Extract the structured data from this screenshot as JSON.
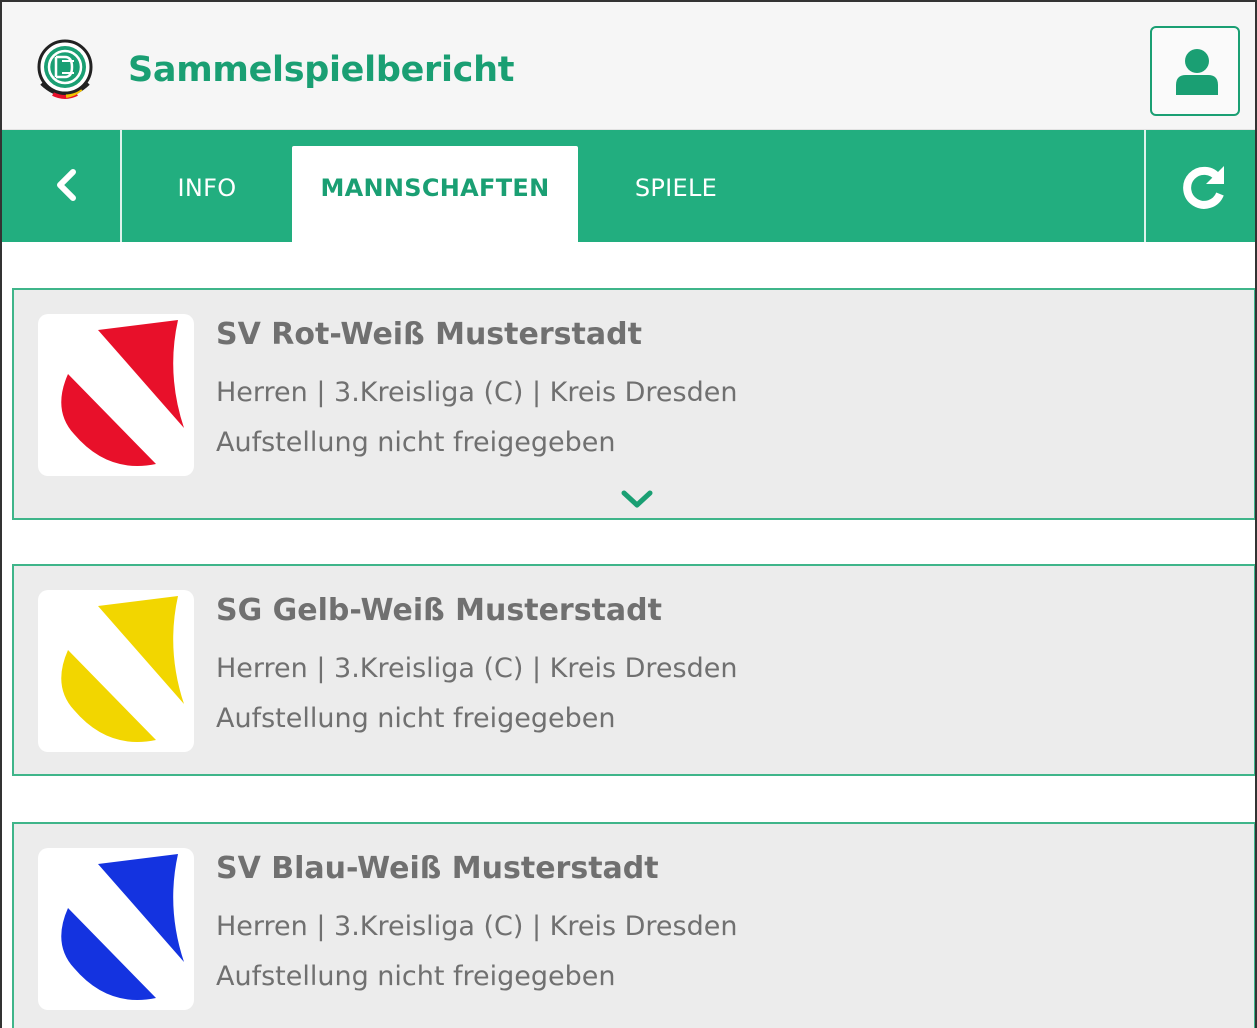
{
  "app": {
    "title": "Sammelspielbericht",
    "logo_icon": "dfb-logo-icon",
    "profile_icon": "user-icon"
  },
  "colors": {
    "accent": "#22ae7f",
    "accent_text": "#1a9f73",
    "card_bg": "#ececec",
    "card_border": "#3fb58a",
    "text_gray": "#707070"
  },
  "nav": {
    "back_icon": "chevron-left-icon",
    "refresh_icon": "refresh-icon",
    "tabs": [
      {
        "label": "INFO",
        "active": false
      },
      {
        "label": "MANNSCHAFTEN",
        "active": true
      },
      {
        "label": "SPIELE",
        "active": false
      }
    ]
  },
  "teams": [
    {
      "name": "SV Rot-Weiß Musterstadt",
      "league": "Herren | 3.Kreisliga (C) | Kreis Dresden",
      "status": "Aufstellung nicht freigegeben",
      "crest_color": "#e8102a",
      "expand_icon": "chevron-down-icon"
    },
    {
      "name": "SG Gelb-Weiß Musterstadt",
      "league": "Herren | 3.Kreisliga (C) | Kreis Dresden",
      "status": "Aufstellung nicht freigegeben",
      "crest_color": "#f2d600"
    },
    {
      "name": "SV Blau-Weiß Musterstadt",
      "league": "Herren | 3.Kreisliga (C) | Kreis Dresden",
      "status": "Aufstellung nicht freigegeben",
      "crest_color": "#1433e0"
    }
  ]
}
